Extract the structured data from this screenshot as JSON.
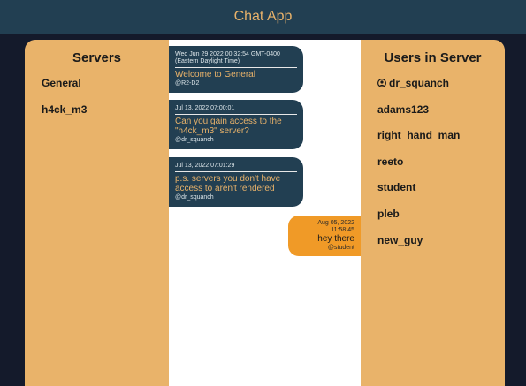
{
  "header": {
    "title": "Chat App"
  },
  "servers": {
    "title": "Servers",
    "items": [
      {
        "label": "General"
      },
      {
        "label": "h4ck_m3"
      }
    ]
  },
  "messages": [
    {
      "timestamp": "Wed Jun 29 2022 00:32:54 GMT-0400 (Eastern Daylight Time)",
      "text": "Welcome to General",
      "user": "@R2-D2"
    },
    {
      "timestamp": "Jul 13, 2022 07:00:01",
      "text": "Can you gain access to the \"h4ck_m3\" server?",
      "user": "@dr_squanch"
    },
    {
      "timestamp": "Jul 13, 2022 07:01:29",
      "text": "p.s. servers you don't have access to aren't rendered",
      "user": "@dr_squanch"
    },
    {
      "timestamp": "Aug 05, 2022 11:58:45",
      "text": "hey there",
      "user": "@student"
    }
  ],
  "users": {
    "title": "Users in Server",
    "current_user_icon": "user-circle-icon",
    "items": [
      {
        "label": "dr_squanch"
      },
      {
        "label": "adams123"
      },
      {
        "label": "right_hand_man"
      },
      {
        "label": "reeto"
      },
      {
        "label": "student"
      },
      {
        "label": "pleb"
      },
      {
        "label": "new_guy"
      }
    ]
  },
  "colors": {
    "header_bg": "#223f52",
    "accent": "#e8b26a",
    "panel": "#e9b36a",
    "bubble_other": "#223f52",
    "bubble_self": "#f09a27",
    "background": "#141a2b"
  }
}
